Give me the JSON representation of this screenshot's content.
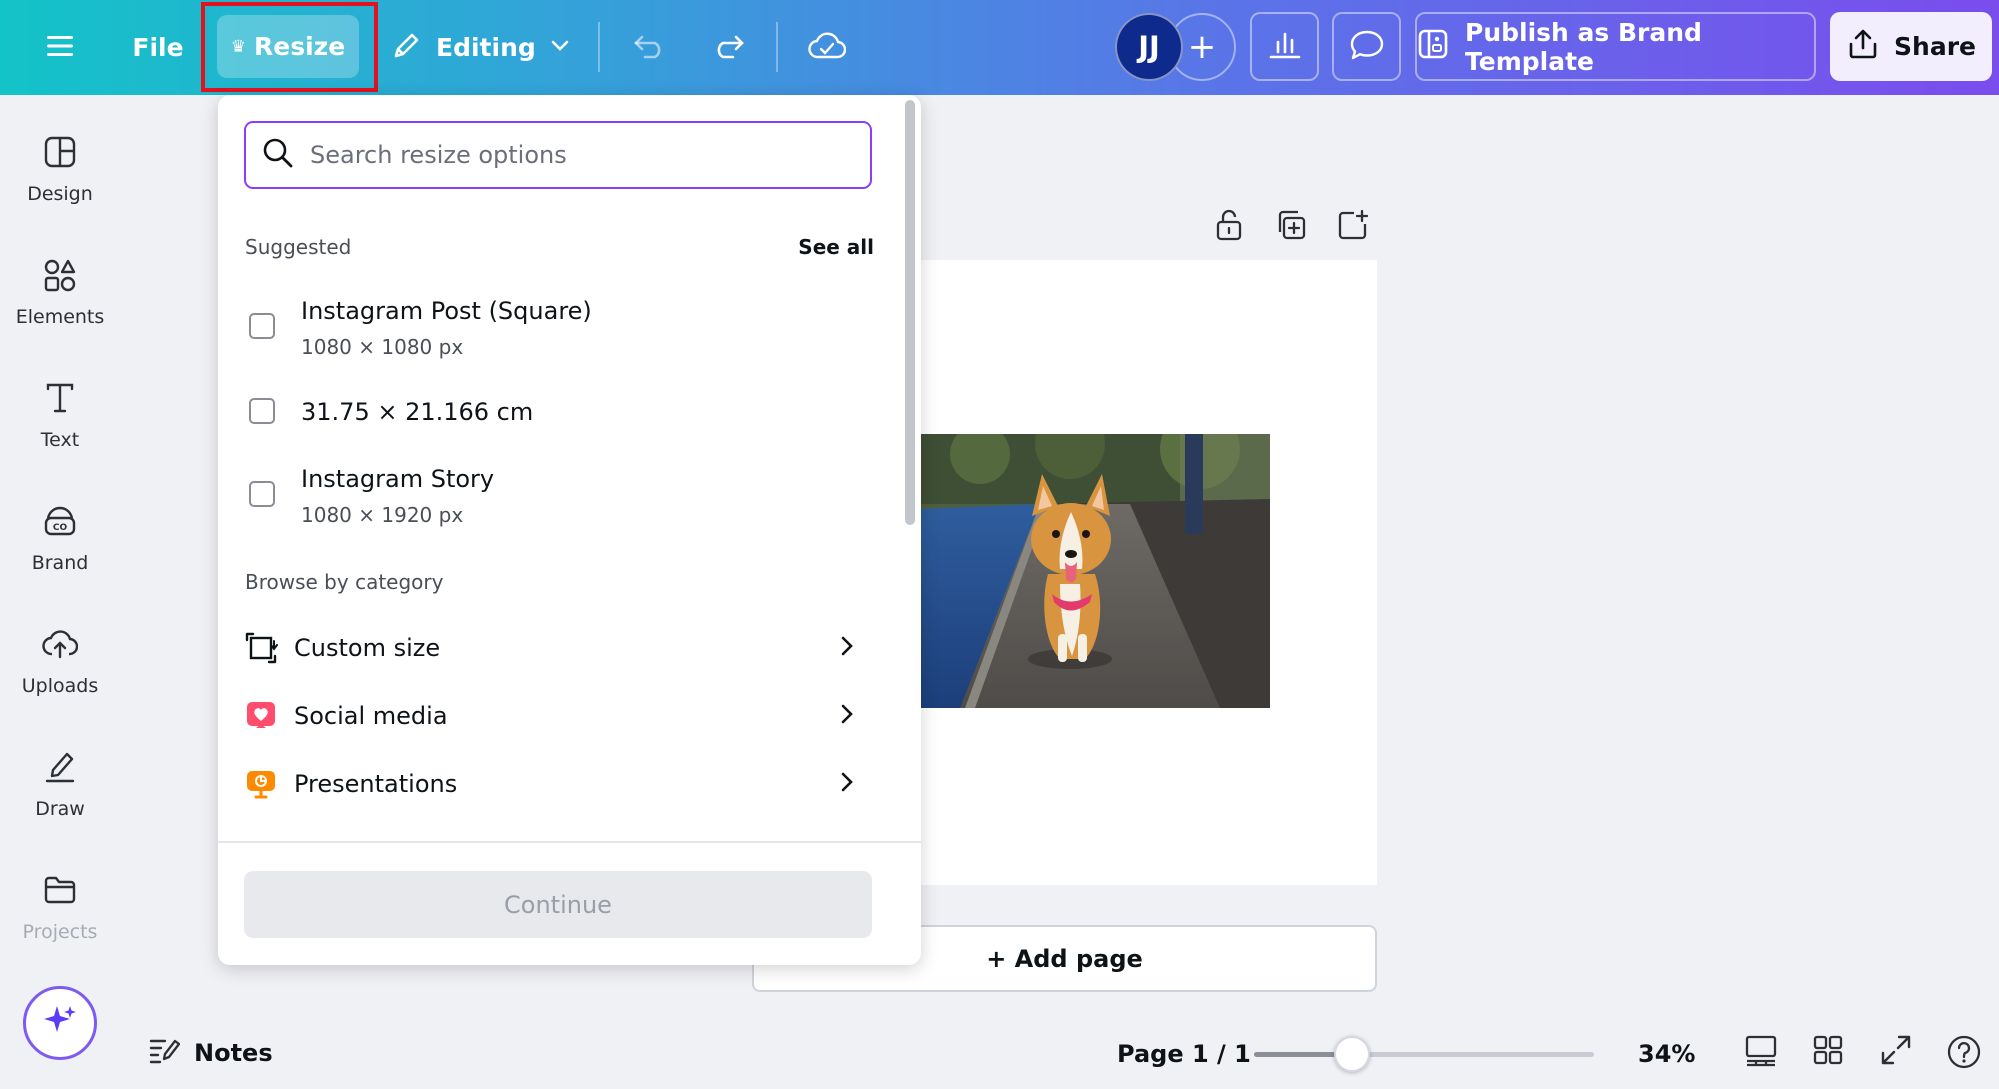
{
  "topbar": {
    "file_label": "File",
    "resize_label": "Resize",
    "editing_label": "Editing",
    "avatar_initials": "JJ",
    "add_collaborator": "+",
    "publish_label": "Publish as Brand Template",
    "share_label": "Share",
    "colors": {
      "gradient_start": "#13c3c8",
      "gradient_end": "#7a4ded",
      "highlight_outline": "#e3121f"
    }
  },
  "sidebar": {
    "items": [
      {
        "label": "Design",
        "icon": "design-icon"
      },
      {
        "label": "Elements",
        "icon": "elements-icon"
      },
      {
        "label": "Text",
        "icon": "text-icon"
      },
      {
        "label": "Brand",
        "icon": "brand-icon"
      },
      {
        "label": "Uploads",
        "icon": "uploads-icon"
      },
      {
        "label": "Draw",
        "icon": "draw-icon"
      },
      {
        "label": "Projects",
        "icon": "projects-icon"
      }
    ]
  },
  "resize_panel": {
    "search_placeholder": "Search resize options",
    "suggested_label": "Suggested",
    "see_all_label": "See all",
    "suggested": [
      {
        "title": "Instagram Post (Square)",
        "subtitle": "1080 × 1080 px"
      },
      {
        "title": "31.75 × 21.166 cm",
        "subtitle": ""
      },
      {
        "title": "Instagram Story",
        "subtitle": "1080 × 1920 px"
      }
    ],
    "browse_label": "Browse by category",
    "categories": [
      {
        "label": "Custom size",
        "icon": "custom-size-icon",
        "color": "#0e1318"
      },
      {
        "label": "Social media",
        "icon": "social-media-heart-icon",
        "color": "#ff4d6d"
      },
      {
        "label": "Presentations",
        "icon": "presentations-icon",
        "color": "#ff8a00"
      }
    ],
    "continue_label": "Continue"
  },
  "canvas": {
    "add_page_label": "+ Add page"
  },
  "bottombar": {
    "notes_label": "Notes",
    "page_indicator": "Page 1 / 1",
    "zoom_label": "34%",
    "zoom_fraction": 0.34
  }
}
